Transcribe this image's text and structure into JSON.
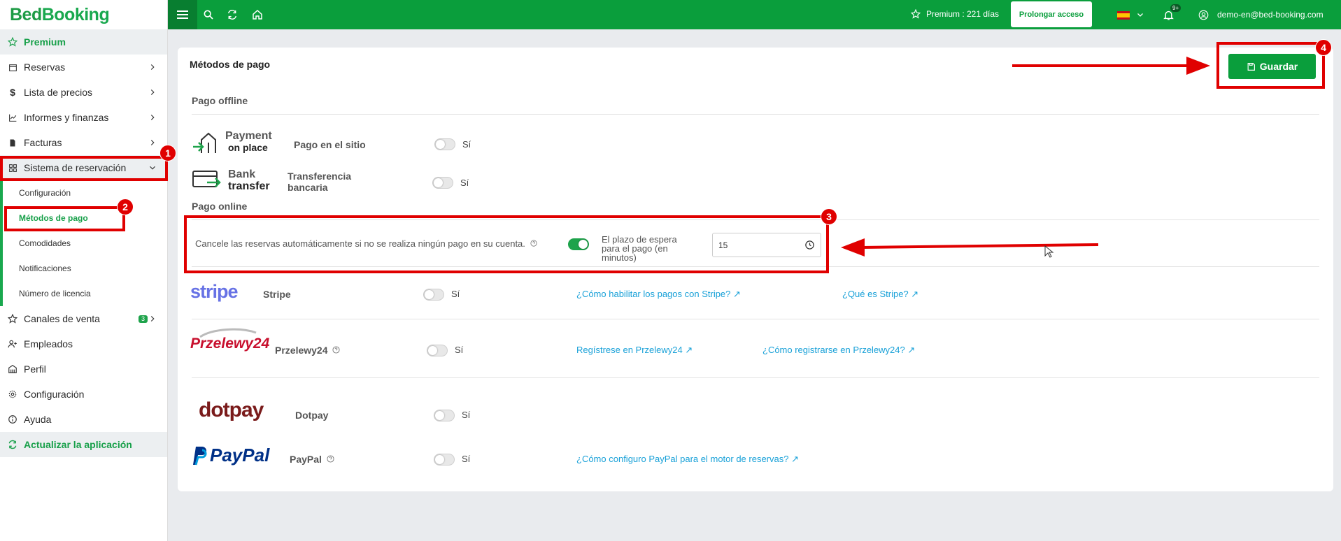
{
  "brand": {
    "part1": "Bed",
    "part2": "Booking"
  },
  "sidebar": {
    "premium": "Premium",
    "items": [
      {
        "label": "Reservas"
      },
      {
        "label": "Lista de precios"
      },
      {
        "label": "Informes y finanzas"
      },
      {
        "label": "Facturas"
      },
      {
        "label": "Sistema de reservación"
      }
    ],
    "subitems": [
      {
        "label": "Configuración"
      },
      {
        "label": "Métodos de pago"
      },
      {
        "label": "Comodidades"
      },
      {
        "label": "Notificaciones"
      },
      {
        "label": "Número de licencia"
      }
    ],
    "items2": [
      {
        "label": "Canales de venta",
        "badge": "3"
      },
      {
        "label": "Empleados"
      },
      {
        "label": "Perfil"
      },
      {
        "label": "Configuración"
      },
      {
        "label": "Ayuda"
      }
    ],
    "update": "Actualizar la aplicación"
  },
  "topbar": {
    "premium_text": "Premium : 221 días",
    "prolong_button": "Prolongar acceso",
    "notif_count": "9+",
    "user_email": "demo-en@bed-booking.com"
  },
  "page": {
    "title": "Métodos de pago",
    "save_button": "Guardar"
  },
  "offline": {
    "heading": "Pago offline",
    "methods": [
      {
        "logo_line1": "Payment",
        "logo_line2": "on place",
        "label": "Pago en el sitio",
        "toggle_text": "Sí"
      },
      {
        "logo_line1": "Bank",
        "logo_line2": "transfer",
        "label_line1": "Transferencia",
        "label_line2": "bancaria",
        "toggle_text": "Sí"
      }
    ]
  },
  "online": {
    "heading": "Pago online",
    "auto_cancel_text": "Cancele las reservas automáticamente si no se realiza ningún pago en su cuenta.",
    "wait_label": "El plazo de espera para el pago (en minutos)",
    "wait_value": "15",
    "methods": [
      {
        "logo": "stripe",
        "label": "Stripe",
        "toggle_text": "Sí",
        "link1": "¿Cómo habilitar los pagos con Stripe?",
        "link2": "¿Qué es Stripe?"
      },
      {
        "logo": "Przelewy24",
        "label": "Przelewy24",
        "toggle_text": "Sí",
        "link1": "Regístrese en Przelewy24",
        "link2": "¿Cómo registrarse en Przelewy24?"
      },
      {
        "logo": "dotpay",
        "label": "Dotpay",
        "toggle_text": "Sí"
      },
      {
        "logo": "PayPal",
        "label": "PayPal",
        "toggle_text": "Sí",
        "link1": "¿Cómo configuro PayPal para el motor de reservas?"
      }
    ]
  },
  "annotations": [
    "1",
    "2",
    "3",
    "4"
  ],
  "colors": {
    "brand_green": "#0a9e3c",
    "annotation_red": "#e00000",
    "link_blue": "#19a1d8"
  }
}
